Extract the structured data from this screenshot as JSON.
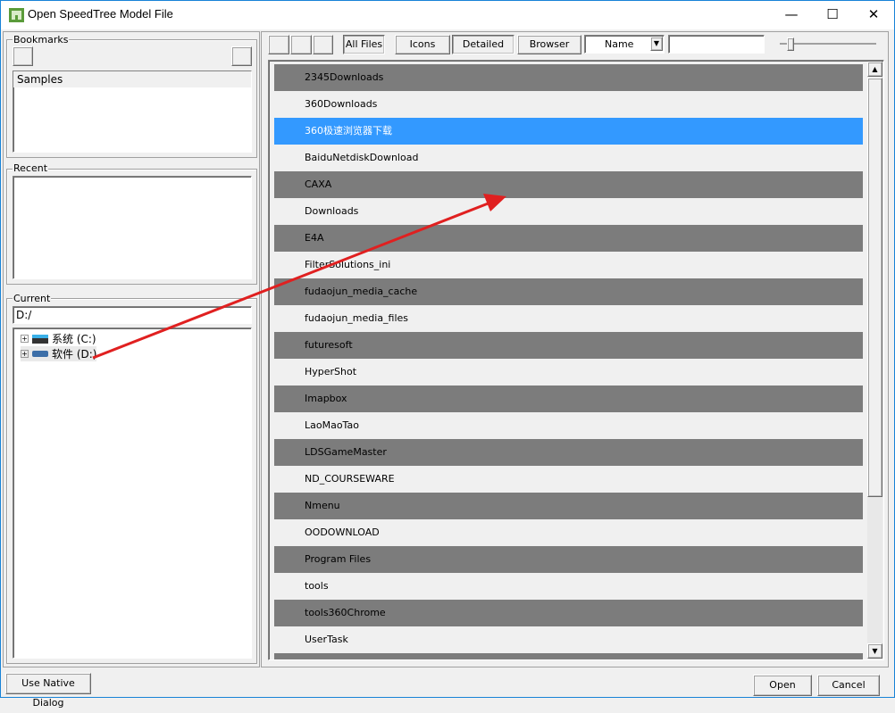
{
  "window": {
    "title": "Open SpeedTree Model File",
    "minimize": "—",
    "maximize": "☐",
    "close": "✕"
  },
  "bookmarks": {
    "label": "Bookmarks",
    "items": [
      "Samples"
    ]
  },
  "recent": {
    "label": "Recent"
  },
  "current": {
    "label": "Current",
    "path": "D:/",
    "drives": [
      {
        "label": "系统 (C:)"
      },
      {
        "label": "软件 (D:)"
      }
    ]
  },
  "toolbar": {
    "all_files": "All Files",
    "icons": "Icons",
    "detailed": "Detailed",
    "browser": "Browser",
    "sort": "Name",
    "filter": ""
  },
  "files": [
    {
      "name": "2345Downloads",
      "style": "g"
    },
    {
      "name": "360Downloads",
      "style": ""
    },
    {
      "name": "360极速浏览器下载",
      "style": "s"
    },
    {
      "name": "BaiduNetdiskDownload",
      "style": ""
    },
    {
      "name": "CAXA",
      "style": "g"
    },
    {
      "name": "Downloads",
      "style": ""
    },
    {
      "name": "E4A",
      "style": "g"
    },
    {
      "name": "FilterSolutions_ini",
      "style": ""
    },
    {
      "name": "fudaojun_media_cache",
      "style": "g"
    },
    {
      "name": "fudaojun_media_files",
      "style": ""
    },
    {
      "name": "futuresoft",
      "style": "g"
    },
    {
      "name": "HyperShot",
      "style": ""
    },
    {
      "name": "Imapbox",
      "style": "g"
    },
    {
      "name": "LaoMaoTao",
      "style": ""
    },
    {
      "name": "LDSGameMaster",
      "style": "g"
    },
    {
      "name": "ND_COURSEWARE",
      "style": ""
    },
    {
      "name": "Nmenu",
      "style": "g"
    },
    {
      "name": "OODOWNLOAD",
      "style": ""
    },
    {
      "name": "Program Files",
      "style": "g"
    },
    {
      "name": "tools",
      "style": ""
    },
    {
      "name": "tools360Chrome",
      "style": "g"
    },
    {
      "name": "UserTask",
      "style": ""
    },
    {
      "name": "",
      "style": "g"
    }
  ],
  "footer": {
    "native": "Use Native Dialog",
    "open": "Open",
    "cancel": "Cancel"
  },
  "colors": {
    "selected": "#3399ff",
    "alt_row": "#7c7c7c",
    "annotation_arrow": "#e02020"
  }
}
